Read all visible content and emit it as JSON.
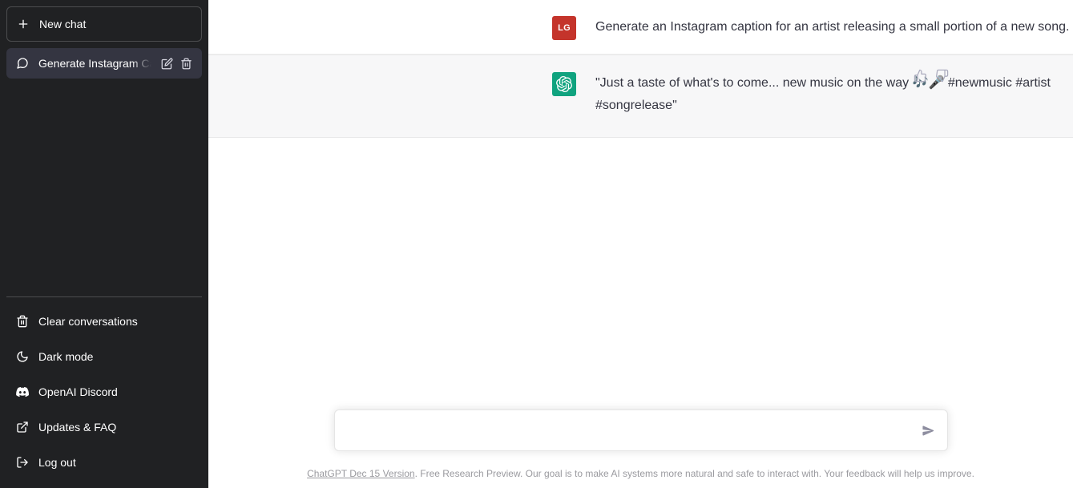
{
  "sidebar": {
    "new_chat_label": "New chat",
    "conversations": [
      {
        "title": "Generate Instagram Caption",
        "icon": "message-icon",
        "active": true
      }
    ],
    "menu": [
      {
        "label": "Clear conversations",
        "icon": "trash-icon"
      },
      {
        "label": "Dark mode",
        "icon": "moon-icon"
      },
      {
        "label": "OpenAI Discord",
        "icon": "discord-icon"
      },
      {
        "label": "Updates & FAQ",
        "icon": "external-link-icon"
      },
      {
        "label": "Log out",
        "icon": "logout-icon"
      }
    ],
    "background_color": "#202123",
    "active_item_color": "#343541"
  },
  "thread": {
    "messages": [
      {
        "role": "user",
        "avatar_initials": "LG",
        "avatar_color": "#c4342b",
        "text": "Generate an Instagram caption for an artist releasing a small portion of a new song."
      },
      {
        "role": "assistant",
        "avatar_initials": "",
        "avatar_color": "#10a37f",
        "text": "\"Just a taste of what's to come... new music on the way 🎶🎤 #newmusic #artist #songrelease\"",
        "actions": [
          "thumbs-up-icon",
          "thumbs-down-icon"
        ]
      }
    ]
  },
  "composer": {
    "value": "",
    "placeholder": "",
    "send_icon": "send-icon"
  },
  "footer": {
    "version_link": "ChatGPT Dec 15 Version",
    "disclaimer": ". Free Research Preview. Our goal is to make AI systems more natural and safe to interact with. Your feedback will help us improve."
  }
}
